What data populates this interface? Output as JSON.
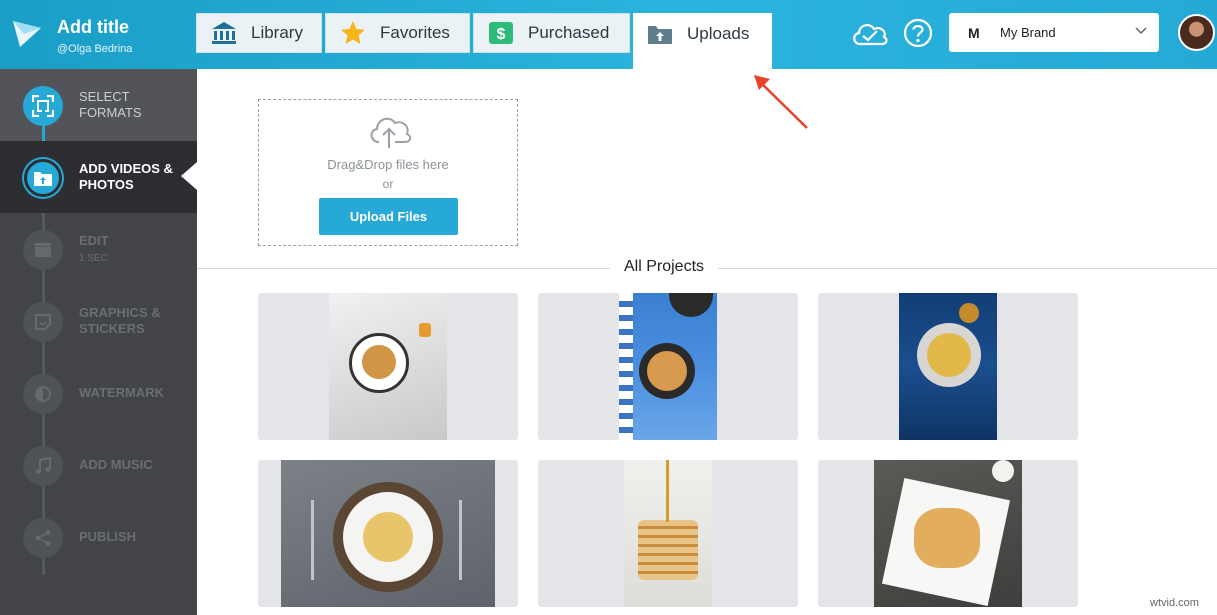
{
  "header": {
    "title": "Add title",
    "username": "@Olga Bedrina",
    "tabs": [
      {
        "label": "Library",
        "icon": "library-icon"
      },
      {
        "label": "Favorites",
        "icon": "star-icon"
      },
      {
        "label": "Purchased",
        "icon": "dollar-icon"
      },
      {
        "label": "Uploads",
        "icon": "folder-upload-icon"
      }
    ],
    "brand": {
      "badge": "M",
      "name": "My Brand"
    }
  },
  "sidebar": {
    "steps": [
      {
        "label": "SELECT FORMATS"
      },
      {
        "label": "ADD VIDEOS & PHOTOS"
      },
      {
        "label": "EDIT",
        "sub": "1 sec"
      },
      {
        "label": "GRAPHICS & STICKERS"
      },
      {
        "label": "WATERMARK"
      },
      {
        "label": "ADD MUSIC"
      },
      {
        "label": "PUBLISH"
      }
    ]
  },
  "upload": {
    "drag_text": "Drag&Drop files here",
    "or_text": "or",
    "button_label": "Upload Files"
  },
  "projects": {
    "heading": "All Projects"
  },
  "colors": {
    "accent": "#27a9d7",
    "sidebar": "#424449",
    "header": "#2bb3dd",
    "arrow": "#e8412c"
  },
  "watermark": "wtvid.com"
}
